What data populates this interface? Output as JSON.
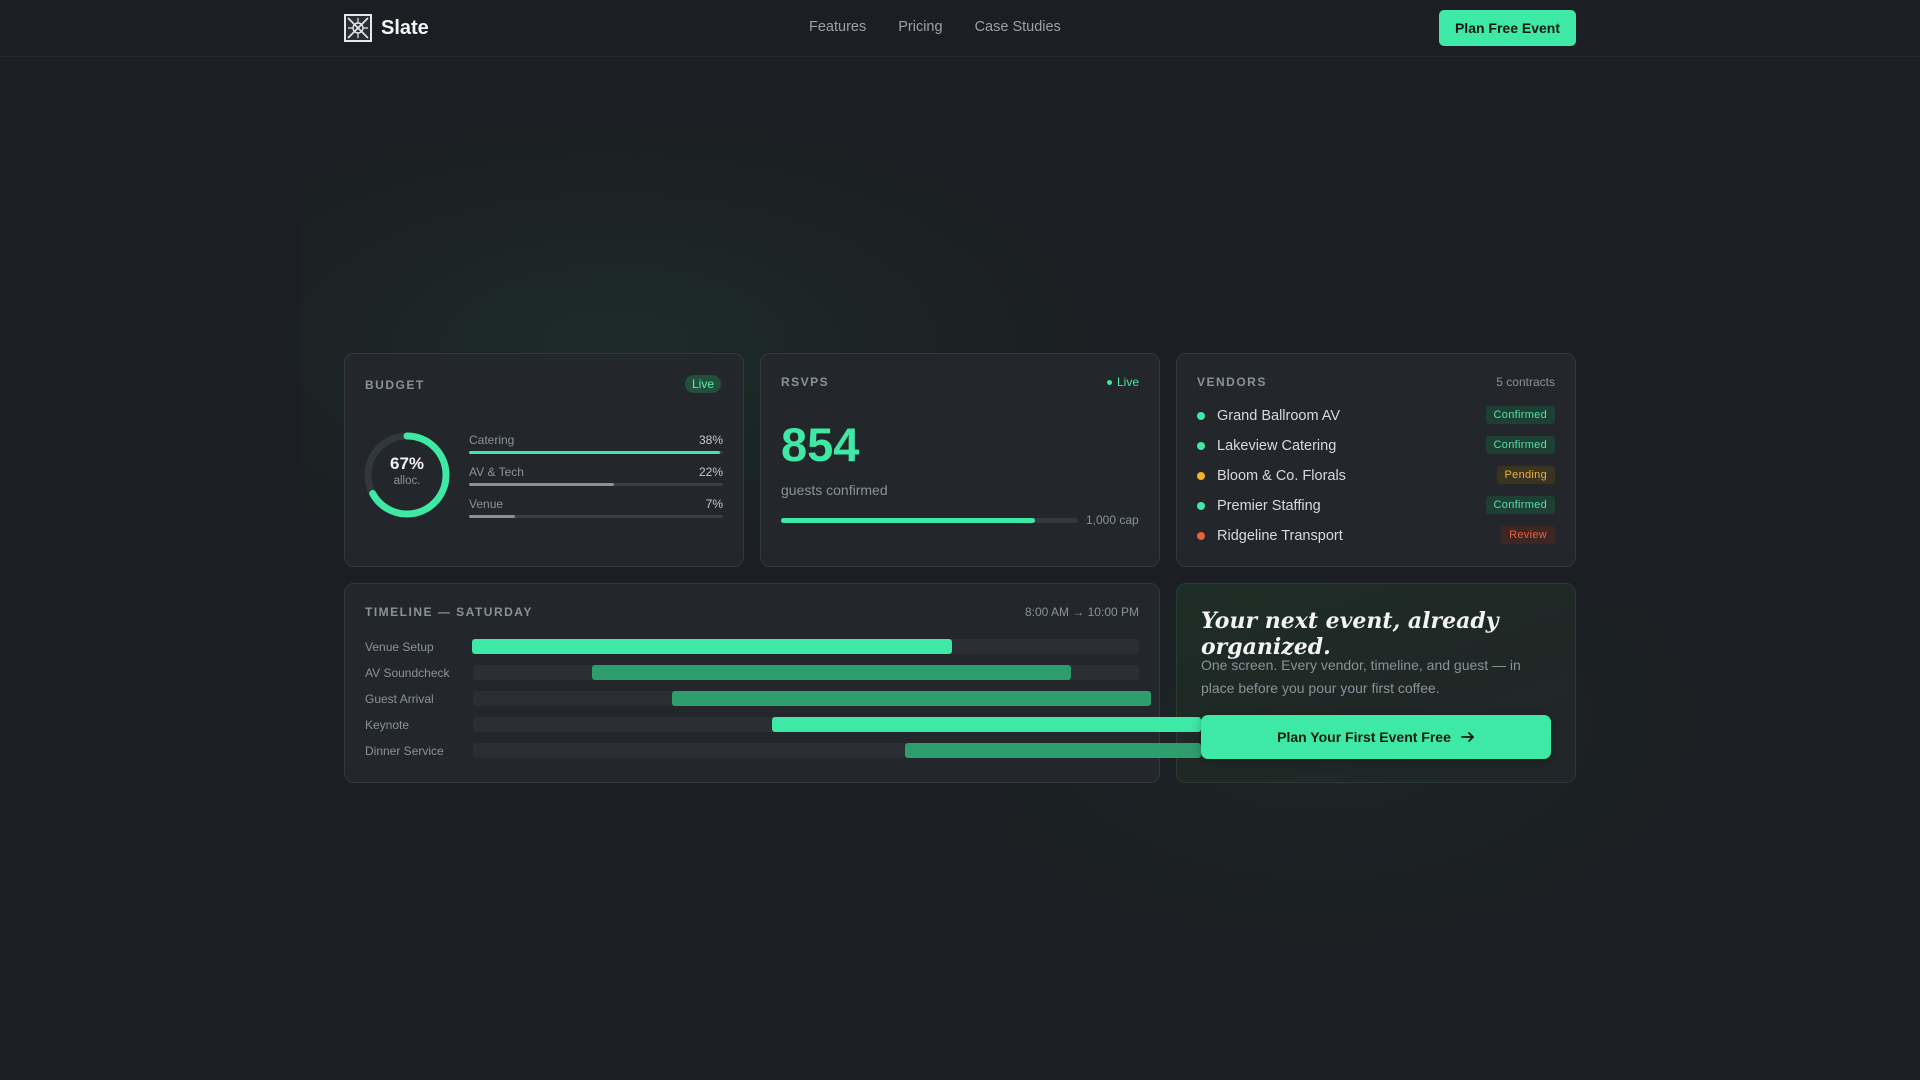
{
  "app": {
    "name": "Slate"
  },
  "nav": {
    "links": [
      "Features",
      "Pricing",
      "Case Studies"
    ],
    "cta": "Plan Free Event"
  },
  "budget": {
    "title": "BUDGET",
    "badge": "Live",
    "ring_value": "67%",
    "ring_sub": "alloc.",
    "ring_fraction": 0.67,
    "rows": [
      {
        "label": "Catering",
        "value": "38%",
        "fill": 0.99,
        "color": "#3ee8a5"
      },
      {
        "label": "AV & Tech",
        "value": "22%",
        "fill": 0.57,
        "color": "#8a9299"
      },
      {
        "label": "Venue",
        "value": "7%",
        "fill": 0.18,
        "color": "#8a9299"
      }
    ]
  },
  "rsvps": {
    "title": "RSVPS",
    "badge": "Live",
    "count": "854",
    "sub": "guests confirmed",
    "cap": "1,000 cap",
    "fill": 0.854
  },
  "vendors": {
    "title": "VENDORS",
    "count": "5 contracts",
    "items": [
      {
        "name": "Grand Ballroom AV",
        "status": "Confirmed",
        "color": "#3ee8a5"
      },
      {
        "name": "Lakeview Catering",
        "status": "Confirmed",
        "color": "#3ee8a5"
      },
      {
        "name": "Bloom & Co. Florals",
        "status": "Pending",
        "color": "#f0b429"
      },
      {
        "name": "Premier Staffing",
        "status": "Confirmed",
        "color": "#3ee8a5"
      },
      {
        "name": "Ridgeline Transport",
        "status": "Review",
        "color": "#e8603c"
      }
    ]
  },
  "timeline": {
    "title": "TIMELINE — SATURDAY",
    "range": "8:00 AM → 10:00 PM",
    "rows": [
      {
        "label": "Venue Setup",
        "start": 0.0,
        "end": 0.72,
        "color": "#3ee8a5"
      },
      {
        "label": "AV Soundcheck",
        "start": 0.18,
        "end": 0.9,
        "color": "#2f9e6e"
      },
      {
        "label": "Guest Arrival",
        "start": 0.3,
        "end": 1.02,
        "color": "#2f9e6e"
      },
      {
        "label": "Keynote",
        "start": 0.45,
        "end": 1.17,
        "color": "#3ee8a5"
      },
      {
        "label": "Dinner Service",
        "start": 0.65,
        "end": 1.37,
        "color": "#2f9e6e"
      }
    ]
  },
  "promo": {
    "headline": "Your next event, already organized.",
    "body": "One screen. Every vendor, timeline, and guest — in place before you pour your first coffee.",
    "cta": "Plan Your First Event Free"
  }
}
